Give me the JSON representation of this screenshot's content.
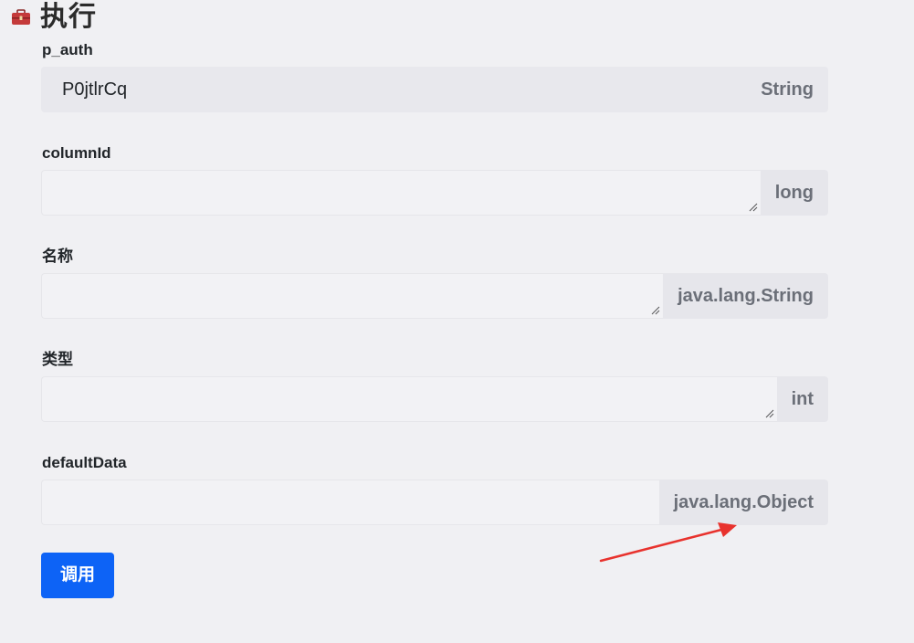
{
  "header": {
    "icon": "toolbox-icon",
    "title": "执行"
  },
  "fields": [
    {
      "label": "p_auth",
      "value": "P0jtlrCq",
      "type": "String",
      "readonly": true
    },
    {
      "label": "columnId",
      "value": "",
      "type": "long",
      "readonly": false,
      "resizable": true
    },
    {
      "label": "名称",
      "value": "",
      "type": "java.lang.String",
      "readonly": false,
      "resizable": true
    },
    {
      "label": "类型",
      "value": "",
      "type": "int",
      "readonly": false,
      "resizable": true
    },
    {
      "label": "defaultData",
      "value": "",
      "type": "java.lang.Object",
      "readonly": false,
      "resizable": false
    }
  ],
  "actions": {
    "invoke_label": "调用"
  },
  "colors": {
    "background": "#f0f0f3",
    "addon_bg": "#e6e6eb",
    "addon_text": "#6b6f78",
    "primary": "#0d63f6",
    "annotation": "#e8322d"
  }
}
